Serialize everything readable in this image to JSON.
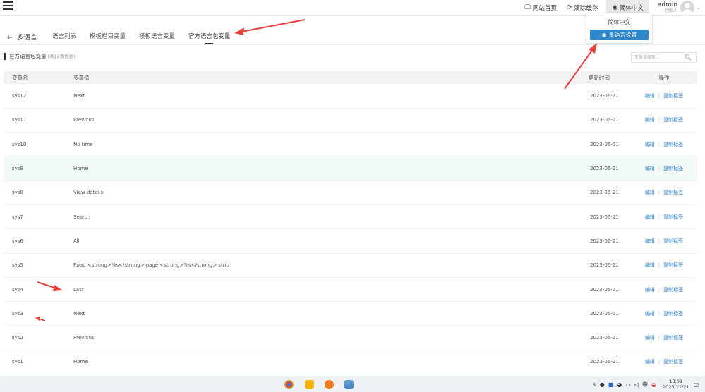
{
  "topbar": {
    "home_label": "网站首页",
    "cache_label": "清除缓存",
    "lang_label": "简体中文",
    "user_name": "admin",
    "user_role": "创始人"
  },
  "dropdown": {
    "current": "简体中文",
    "settings": "多语言设置"
  },
  "tabs": {
    "back": "多语言",
    "items": [
      "语言列表",
      "模板栏目变量",
      "模板语言变量",
      "官方语言包变量"
    ]
  },
  "section": {
    "title": "官方语言包变量",
    "count": "(共12条数据)"
  },
  "search": {
    "placeholder": "变量值搜索..."
  },
  "table": {
    "headers": [
      "变量名",
      "变量值",
      "更新时间",
      "操作"
    ],
    "edit_label": "编辑",
    "copy_label": "复制标签",
    "rows": [
      {
        "name": "sys12",
        "value": "Next",
        "time": "2023-06-21"
      },
      {
        "name": "sys11",
        "value": "Previous",
        "time": "2023-06-21"
      },
      {
        "name": "sys10",
        "value": "No time",
        "time": "2023-06-21"
      },
      {
        "name": "sys9",
        "value": "Home",
        "time": "2023-06-21"
      },
      {
        "name": "sys8",
        "value": "View details",
        "time": "2023-06-21"
      },
      {
        "name": "sys7",
        "value": "Search",
        "time": "2023-06-21"
      },
      {
        "name": "sys6",
        "value": "All",
        "time": "2023-06-21"
      },
      {
        "name": "sys5",
        "value": "Road <strong>%s</strong> page <strong>%s</strong> strip",
        "time": "2023-06-21"
      },
      {
        "name": "sys4",
        "value": "Last",
        "time": "2023-06-21"
      },
      {
        "name": "sys3",
        "value": "Next",
        "time": "2023-06-21"
      },
      {
        "name": "sys2",
        "value": "Previous",
        "time": "2023-06-21"
      },
      {
        "name": "sys1",
        "value": "Home",
        "time": "2023-06-21"
      }
    ]
  },
  "taskbar": {
    "time": "13:09",
    "date": "2023/11/21"
  },
  "colors": {
    "accent": "#2e87c9",
    "link": "#2c7ac4",
    "annotation": "#e8413c",
    "highlight_row": "#f2faf8"
  }
}
